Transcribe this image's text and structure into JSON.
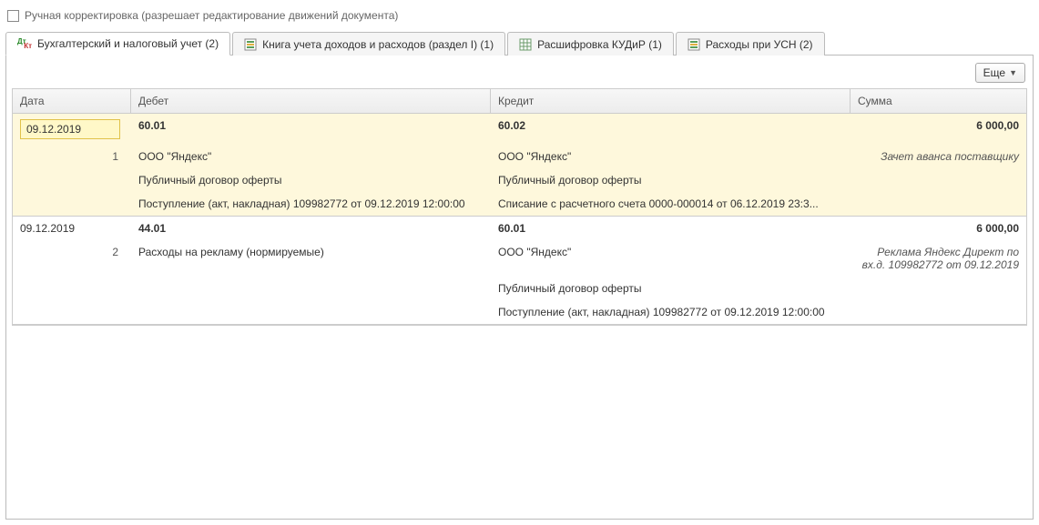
{
  "checkbox_label": "Ручная корректировка (разрешает редактирование движений документа)",
  "tabs": [
    {
      "label": "Бухгалтерский и налоговый учет (2)"
    },
    {
      "label": "Книга учета доходов и расходов (раздел I) (1)"
    },
    {
      "label": "Расшифровка КУДиР (1)"
    },
    {
      "label": "Расходы при УСН (2)"
    }
  ],
  "more_button": "Еще",
  "columns": {
    "date": "Дата",
    "debit": "Дебет",
    "credit": "Кредит",
    "sum": "Сумма"
  },
  "entries": [
    {
      "date": "09.12.2019",
      "num": "1",
      "debit_account": "60.01",
      "credit_account": "60.02",
      "sum": "6 000,00",
      "debit_lines": [
        "ООО \"Яндекс\"",
        "Публичный договор оферты",
        "Поступление (акт, накладная) 109982772 от 09.12.2019 12:00:00"
      ],
      "credit_lines": [
        "ООО \"Яндекс\"",
        "Публичный договор оферты",
        "Списание с расчетного счета 0000-000014 от 06.12.2019 23:3..."
      ],
      "note": "Зачет аванса поставщику"
    },
    {
      "date": "09.12.2019",
      "num": "2",
      "debit_account": "44.01",
      "credit_account": "60.01",
      "sum": "6 000,00",
      "debit_lines": [
        "Расходы на рекламу (нормируемые)"
      ],
      "credit_lines": [
        "ООО \"Яндекс\"",
        "Публичный договор оферты",
        "Поступление (акт, накладная) 109982772 от 09.12.2019 12:00:00"
      ],
      "note": "Реклама Яндекс Директ по вх.д. 109982772 от 09.12.2019"
    }
  ]
}
